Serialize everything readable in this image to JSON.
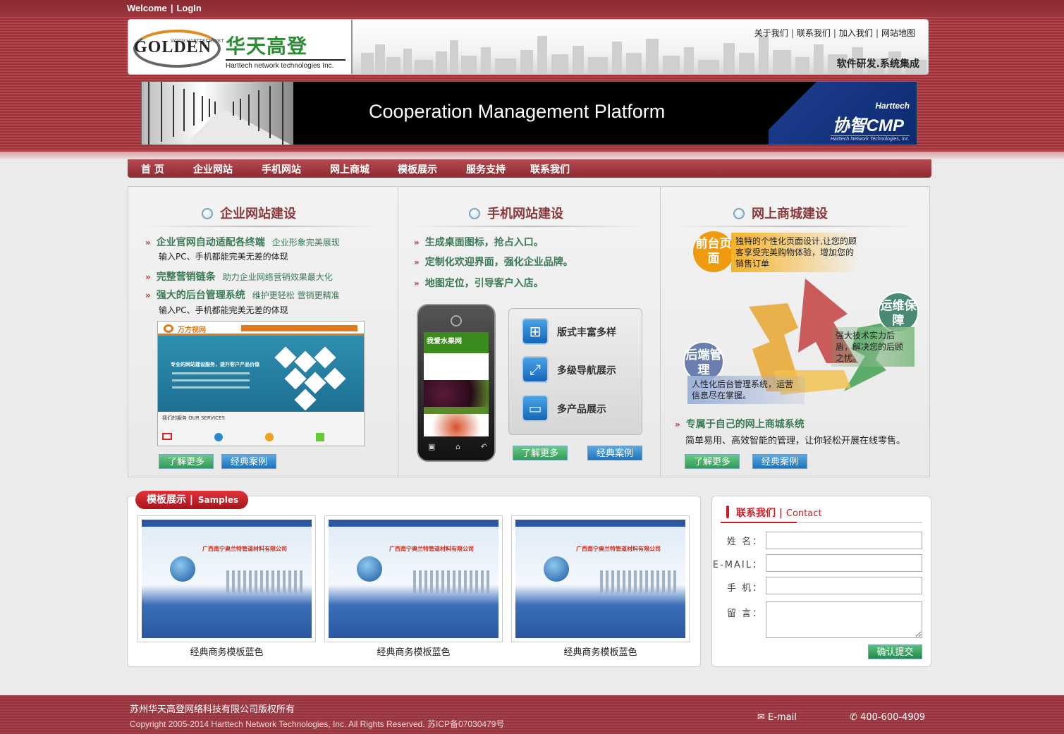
{
  "top": {
    "welcome": "Welcome",
    "sep": "|",
    "login": "LogIn"
  },
  "header": {
    "logo_golden": "GOLDEN",
    "logo_net": "WWW.HARTTECH.NET",
    "logo_cn": "华天高登",
    "logo_en": "Harttech network technologies Inc.",
    "links": [
      "关于我们",
      "联系我们",
      "加入我们",
      "网站地图"
    ],
    "slogan": "软件研发.系统集成"
  },
  "banner": {
    "title": "Cooperation Management Platform",
    "brand_small": "Harttech",
    "brand_name": "协智CMP",
    "brand_sub": "Harttech Network Technologies, Inc."
  },
  "nav": [
    "首 页",
    "企业网站",
    "手机网站",
    "网上商城",
    "模板展示",
    "服务支持",
    "联系我们"
  ],
  "panel1": {
    "title": "企业网站建设",
    "b1": "企业官网自动适配各终端",
    "b1_side": "企业形象完美展现",
    "b1_sub": "输入PC、手机都能完美无差的体现",
    "b2": "完整营销链条",
    "b2_side": "助力企业网络营销效果最大化",
    "b3": "强大的后台管理系统",
    "b3_side": "维护更轻松 营销更精准",
    "b3_sub": "输入PC、手机都能完美无差的体现",
    "thumb_brand": "万方视网",
    "thumb_headline": "专业的网站建设服务，提升客户产品价值",
    "thumb_services": "我们的服务 OUR SERVICES",
    "more": "了解更多",
    "cases": "经典案例"
  },
  "panel2": {
    "title": "手机网站建设",
    "b1": "生成桌面图标，抢占入口。",
    "b2": "定制化欢迎界面，强化企业品牌。",
    "b3": "地图定位，引导客户入店。",
    "phone_title": "我爱水果网",
    "f1": "版式丰富多样",
    "f2": "多级导航展示",
    "f3": "多产品展示",
    "more": "了解更多",
    "cases": "经典案例"
  },
  "panel3": {
    "title": "网上商城建设",
    "front_badge": "前台页面",
    "front_tip": "独特的个性化页面设计,让您的顾客享受完美购物体验，增加您的销售订单",
    "ops_badge": "运维保障",
    "ops_tip": "强大技术实力后盾，解决您的后顾之忧。",
    "back_badge": "后端管理",
    "back_tip": "人性化后台管理系统，运营信息尽在掌握。",
    "b1": "专属于自己的网上商城系统",
    "b1_sub": "简单易用、高效智能的管理，让你轻松开展在线零售。",
    "more": "了解更多",
    "cases": "经典案例"
  },
  "samples": {
    "tab_cn": "模板展示",
    "tab_sep": "|",
    "tab_en": "Samples",
    "items": [
      {
        "caption": "经典商务模板蓝色",
        "headline": "广西南宁奥兰特管道材料有限公司"
      },
      {
        "caption": "经典商务模板蓝色",
        "headline": "广西南宁奥兰特管道材料有限公司"
      },
      {
        "caption": "经典商务模板蓝色",
        "headline": "广西南宁奥兰特管道材料有限公司"
      }
    ]
  },
  "contact": {
    "title_cn": "联系我们",
    "title_sep": "|",
    "title_en": "Contact",
    "name_label": "姓 名：",
    "email_label": "E-MAIL：",
    "phone_label": "手 机：",
    "msg_label": "留 言：",
    "submit": "确认提交"
  },
  "footer": {
    "company": "苏州华天高登网络科技有限公司版权所有",
    "copyright": "Copyright 2005-2014 Harttech Network Technologies, Inc. All Rights Reserved. 苏ICP备07030479号",
    "email": "E-mail",
    "phone": "400-600-4909"
  },
  "colors": {
    "brand_red": "#9c3039",
    "accent_green": "#2f9b56",
    "accent_blue": "#1c74bd",
    "heading_red": "#c81d25"
  }
}
